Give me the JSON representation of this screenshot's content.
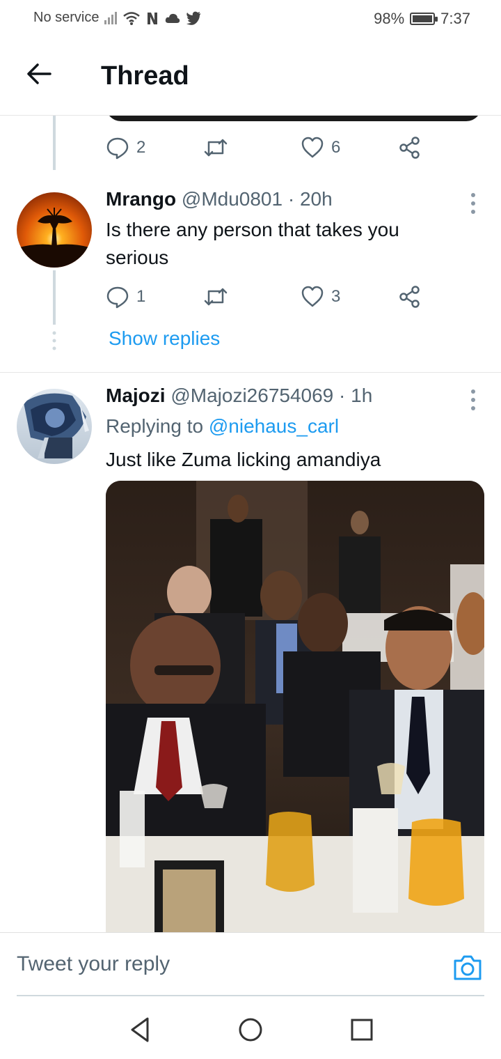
{
  "status_bar": {
    "carrier": "No service",
    "battery": "98%",
    "battery_level": 0.98,
    "time": "7:37"
  },
  "header": {
    "title": "Thread"
  },
  "previous_tweet": {
    "reply_count": "2",
    "like_count": "6"
  },
  "tweet_1": {
    "name": "Mrango",
    "handle": "@Mdu0801",
    "time": "· 20h",
    "text": "Is there any person that takes you serious",
    "reply_count": "1",
    "like_count": "3",
    "show_replies": "Show replies"
  },
  "tweet_2": {
    "name": "Majozi",
    "handle": "@Majozi26754069",
    "time": "· 1h",
    "replying_prefix": "Replying to",
    "replying_handle": "@niehaus_carl",
    "text": "Just like Zuma licking amandiya"
  },
  "reply_bar": {
    "placeholder": "Tweet your reply"
  },
  "colors": {
    "accent": "#1d9bf0",
    "secondary_text": "#536471",
    "thread_line": "#cfd9de"
  }
}
